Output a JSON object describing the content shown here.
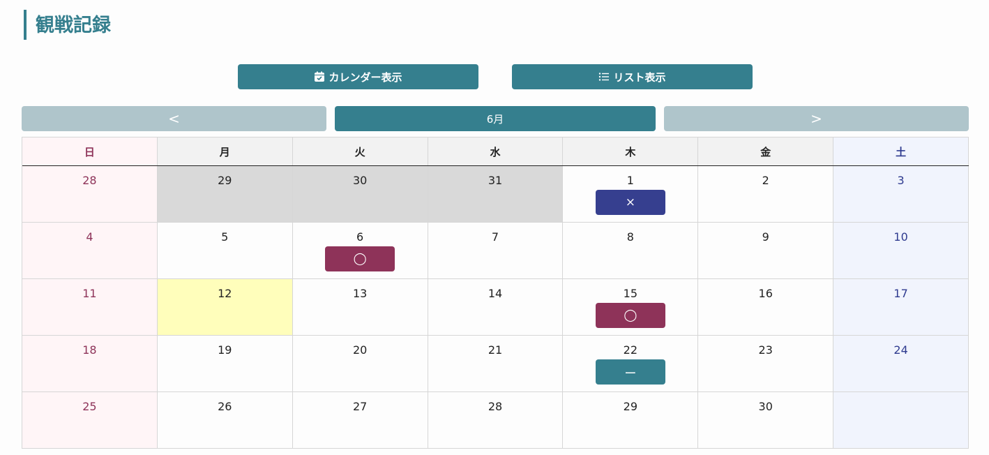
{
  "page": {
    "title": "観戦記録"
  },
  "view_toggle": {
    "calendar_label": "カレンダー表示",
    "list_label": "リスト表示"
  },
  "month_nav": {
    "prev_label": "<",
    "month_label": "6月",
    "next_label": ">"
  },
  "weekdays": [
    "日",
    "月",
    "火",
    "水",
    "木",
    "金",
    "土"
  ],
  "colors": {
    "accent": "#357f8e",
    "nav_inactive": "#afc5cb",
    "sunday": "#8e3359",
    "saturday": "#2e3a8f",
    "result_win": "#8e3359",
    "result_loss": "#363f8f",
    "result_draw": "#357f8e",
    "today": "#fffebb",
    "other_month": "#d9d9d9"
  },
  "weeks": [
    [
      {
        "day": "28"
      },
      {
        "day": "29",
        "other": true
      },
      {
        "day": "30",
        "other": true
      },
      {
        "day": "31",
        "other": true
      },
      {
        "day": "1",
        "result": "×",
        "result_type": "loss"
      },
      {
        "day": "2"
      },
      {
        "day": "3"
      }
    ],
    [
      {
        "day": "4"
      },
      {
        "day": "5"
      },
      {
        "day": "6",
        "result": "◯",
        "result_type": "win"
      },
      {
        "day": "7"
      },
      {
        "day": "8"
      },
      {
        "day": "9"
      },
      {
        "day": "10"
      }
    ],
    [
      {
        "day": "11"
      },
      {
        "day": "12",
        "today": true
      },
      {
        "day": "13"
      },
      {
        "day": "14"
      },
      {
        "day": "15",
        "result": "◯",
        "result_type": "win"
      },
      {
        "day": "16"
      },
      {
        "day": "17"
      }
    ],
    [
      {
        "day": "18"
      },
      {
        "day": "19"
      },
      {
        "day": "20"
      },
      {
        "day": "21"
      },
      {
        "day": "22",
        "result": "ー",
        "result_type": "draw"
      },
      {
        "day": "23"
      },
      {
        "day": "24"
      }
    ],
    [
      {
        "day": "25"
      },
      {
        "day": "26"
      },
      {
        "day": "27"
      },
      {
        "day": "28"
      },
      {
        "day": "29"
      },
      {
        "day": "30"
      },
      {
        "day": ""
      }
    ]
  ]
}
